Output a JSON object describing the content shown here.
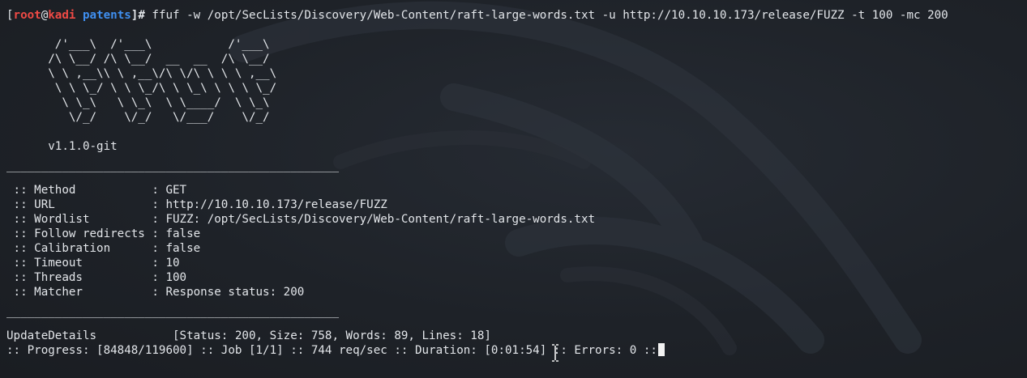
{
  "prompt": {
    "open_bracket": "[",
    "user": "root",
    "at": "@",
    "host": "kadi",
    "dir": "patents",
    "close": "]#",
    "command": "ffuf -w /opt/SecLists/Discovery/Web-Content/raft-large-words.txt -u http://10.10.10.173/release/FUZZ -t 100 -mc 200"
  },
  "banner": [
    "       /'___\\  /'___\\           /'___\\       ",
    "      /\\ \\__/ /\\ \\__/  __  __  /\\ \\__/       ",
    "      \\ \\ ,__\\\\ \\ ,__\\/\\ \\/\\ \\ \\ \\ ,__\\      ",
    "       \\ \\ \\_/ \\ \\ \\_/\\ \\ \\_\\ \\ \\ \\ \\_/      ",
    "        \\ \\_\\   \\ \\_\\  \\ \\____/  \\ \\_\\       ",
    "         \\/_/    \\/_/   \\/___/    \\/_/       "
  ],
  "version": "      v1.1.0-git",
  "separator": "________________________________________________",
  "config": [
    " :: Method           : GET",
    " :: URL              : http://10.10.10.173/release/FUZZ",
    " :: Wordlist         : FUZZ: /opt/SecLists/Discovery/Web-Content/raft-large-words.txt",
    " :: Follow redirects : false",
    " :: Calibration      : false",
    " :: Timeout          : 10",
    " :: Threads          : 100",
    " :: Matcher          : Response status: 200"
  ],
  "result": "UpdateDetails           [Status: 200, Size: 758, Words: 89, Lines: 18]",
  "progress": ":: Progress: [84848/119600] :: Job [1/1] :: 744 req/sec :: Duration: [0:01:54] :: Errors: 0 ::"
}
